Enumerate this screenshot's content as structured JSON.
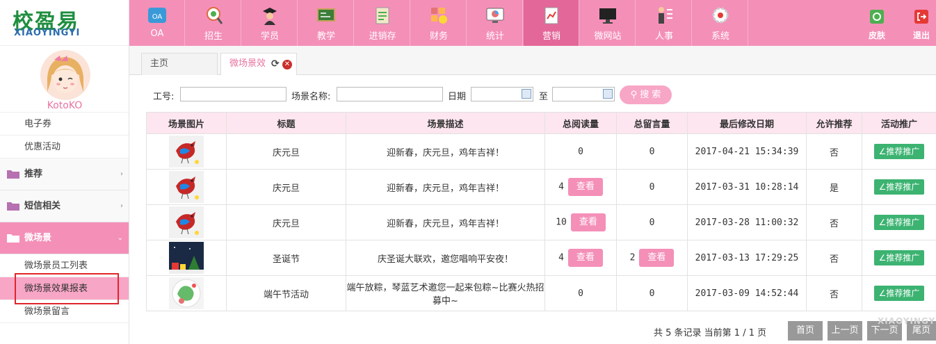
{
  "brand": {
    "cn": "校盈易",
    "en": "XIAOYINGYI"
  },
  "user": {
    "name": "KotoKO"
  },
  "sidebar": {
    "items": [
      "电子券",
      "优惠活动"
    ],
    "groups": [
      {
        "label": "推荐",
        "arrow": "›"
      },
      {
        "label": "短信相关",
        "arrow": "›"
      },
      {
        "label": "微场景",
        "arrow": "⌄"
      }
    ],
    "sub_items": [
      "微场景员工列表",
      "微场景效果报表",
      "微场景留言"
    ]
  },
  "topnav": {
    "items": [
      "OA",
      "招生",
      "学员",
      "教学",
      "进销存",
      "财务",
      "统计",
      "营销",
      "微网站",
      "人事",
      "系统"
    ],
    "oa_icon_text": "OA",
    "skin": "皮肤",
    "logout": "退出"
  },
  "tabs": {
    "home": "主页",
    "current": "微场景效"
  },
  "search": {
    "id_label": "工号:",
    "scene_label": "场景名称:",
    "date_label": "日期",
    "to_label": "至",
    "button": "搜 索"
  },
  "table": {
    "headers": [
      "场景图片",
      "标题",
      "场景描述",
      "总阅读量",
      "总留言量",
      "最后修改日期",
      "允许推荐",
      "活动推广"
    ],
    "view_label": "查看",
    "promo_label": "∠推荐推广",
    "rows": [
      {
        "title": "庆元旦",
        "desc": "迎新春，庆元旦，鸡年吉祥！",
        "reads": "0",
        "reads_btn": false,
        "msgs": "0",
        "msgs_btn": false,
        "date": "2017-04-21 15:34:39",
        "allow": "否",
        "thumb": "bird"
      },
      {
        "title": "庆元旦",
        "desc": "迎新春，庆元旦，鸡年吉祥！",
        "reads": "4",
        "reads_btn": true,
        "msgs": "0",
        "msgs_btn": false,
        "date": "2017-03-31 10:28:14",
        "allow": "是",
        "thumb": "bird"
      },
      {
        "title": "庆元旦",
        "desc": "迎新春，庆元旦，鸡年吉祥！",
        "reads": "10",
        "reads_btn": true,
        "msgs": "0",
        "msgs_btn": false,
        "date": "2017-03-28 11:00:32",
        "allow": "否",
        "thumb": "bird"
      },
      {
        "title": "圣诞节",
        "desc": "庆圣诞大联欢，邀您唱响平安夜！",
        "reads": "4",
        "reads_btn": true,
        "msgs": "2",
        "msgs_btn": true,
        "date": "2017-03-13 17:29:25",
        "allow": "否",
        "thumb": "xmas"
      },
      {
        "title": "端午节活动",
        "desc": "端午放粽，琴蓝艺术邀您一起来包粽~比赛火热招募中~",
        "reads": "0",
        "reads_btn": false,
        "msgs": "0",
        "msgs_btn": false,
        "date": "2017-03-09 14:52:44",
        "allow": "否",
        "thumb": "dumpling"
      }
    ]
  },
  "pager": {
    "info": "共 5 条记录 当前第 1 / 1 页",
    "first": "首页",
    "prev": "上一页",
    "next": "下一页",
    "last": "尾页"
  },
  "watermark": "XIAOYINGYI",
  "colors": {
    "pink": "#f48fb8",
    "pink_dark": "#e4679a",
    "green": "#3cb371",
    "red_box": "#e0252b"
  }
}
